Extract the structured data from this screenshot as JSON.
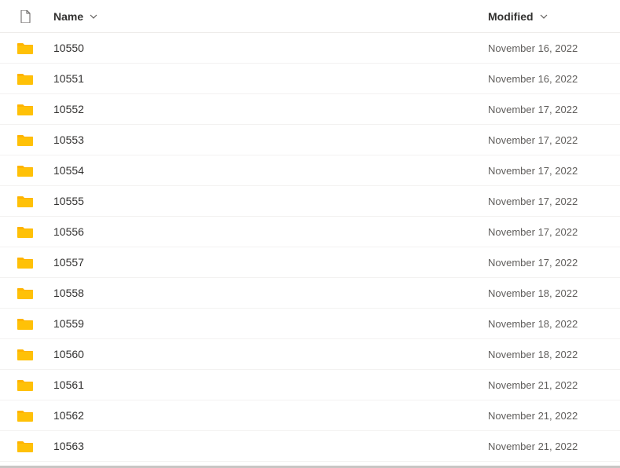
{
  "columns": {
    "name": "Name",
    "modified": "Modified"
  },
  "rows": [
    {
      "name": "10550",
      "modified": "November 16, 2022"
    },
    {
      "name": "10551",
      "modified": "November 16, 2022"
    },
    {
      "name": "10552",
      "modified": "November 17, 2022"
    },
    {
      "name": "10553",
      "modified": "November 17, 2022"
    },
    {
      "name": "10554",
      "modified": "November 17, 2022"
    },
    {
      "name": "10555",
      "modified": "November 17, 2022"
    },
    {
      "name": "10556",
      "modified": "November 17, 2022"
    },
    {
      "name": "10557",
      "modified": "November 17, 2022"
    },
    {
      "name": "10558",
      "modified": "November 18, 2022"
    },
    {
      "name": "10559",
      "modified": "November 18, 2022"
    },
    {
      "name": "10560",
      "modified": "November 18, 2022"
    },
    {
      "name": "10561",
      "modified": "November 21, 2022"
    },
    {
      "name": "10562",
      "modified": "November 21, 2022"
    },
    {
      "name": "10563",
      "modified": "November 21, 2022"
    }
  ]
}
